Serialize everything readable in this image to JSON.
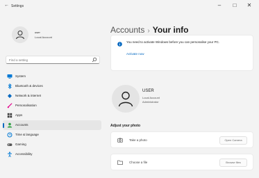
{
  "window": {
    "back_glyph": "←",
    "title": "Settings",
    "minimize_glyph": "–",
    "maximize_glyph": "□",
    "close_glyph": "✕"
  },
  "sidebar": {
    "user_name": "user",
    "user_sub": "Local Account",
    "search_placeholder": "Find a setting",
    "items": [
      {
        "label": "System",
        "icon": "display-icon",
        "color": "#0078d4"
      },
      {
        "label": "Bluetooth & devices",
        "icon": "bluetooth-icon",
        "color": "#0078d4"
      },
      {
        "label": "Network & internet",
        "icon": "wifi-icon",
        "color": "#0067c0"
      },
      {
        "label": "Personalisation",
        "icon": "brush-icon",
        "color": "#e3008c"
      },
      {
        "label": "Apps",
        "icon": "apps-icon",
        "color": "#3a3a3a"
      },
      {
        "label": "Accounts",
        "icon": "person-icon",
        "color": "#2ea043",
        "active": true
      },
      {
        "label": "Time & language",
        "icon": "clock-globe-icon",
        "color": "#0078d4"
      },
      {
        "label": "Gaming",
        "icon": "gamepad-icon",
        "color": "#555555"
      },
      {
        "label": "Accessibility",
        "icon": "accessibility-icon",
        "color": "#0078d4"
      }
    ]
  },
  "main": {
    "breadcrumb_parent": "Accounts",
    "breadcrumb_sep": "›",
    "breadcrumb_current": "Your info",
    "notice": {
      "text": "You need to activate Windows before you can personalise your PC.",
      "link": "Activate now"
    },
    "profile": {
      "name": "USER",
      "sub": "Local Account",
      "role": "Administrator"
    },
    "adjust_title": "Adjust your photo",
    "options": [
      {
        "label": "Take a photo",
        "button": "Open Camera",
        "icon": "camera-icon"
      },
      {
        "label": "Choose a file",
        "button": "Browse files",
        "icon": "folder-icon"
      }
    ]
  },
  "colors": {
    "accent": "#0067c0",
    "background": "#f3f3f3"
  }
}
